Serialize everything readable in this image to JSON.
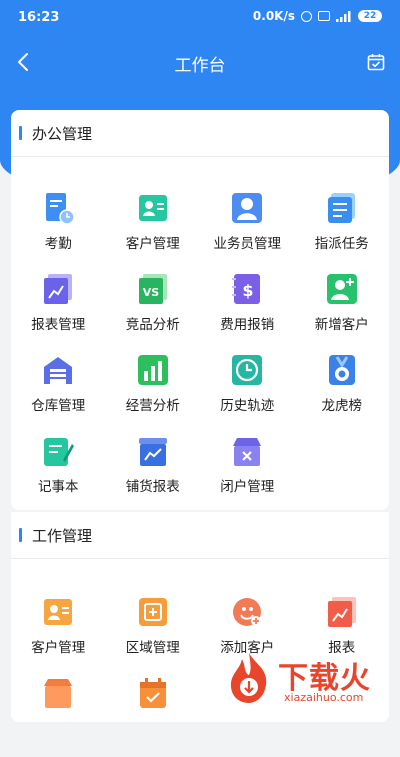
{
  "status_bar": {
    "time": "16:23",
    "network_speed": "0.0K/s",
    "battery": "22"
  },
  "nav": {
    "title": "工作台",
    "back_icon": "chevron-left-icon",
    "right_icon": "calendar-check-icon"
  },
  "colors": {
    "primary": "#2e86f2",
    "section_bar": "#2e86f2"
  },
  "office_section": {
    "title": "办公管理",
    "items": [
      {
        "label": "考勤",
        "icon": "attendance-icon"
      },
      {
        "label": "客户管理",
        "icon": "customer-card-icon"
      },
      {
        "label": "业务员管理",
        "icon": "salesperson-icon"
      },
      {
        "label": "指派任务",
        "icon": "task-list-icon"
      },
      {
        "label": "报表管理",
        "icon": "report-chart-icon"
      },
      {
        "label": "竞品分析",
        "icon": "vs-icon"
      },
      {
        "label": "费用报销",
        "icon": "dollar-notebook-icon"
      },
      {
        "label": "新增客户",
        "icon": "add-user-icon"
      },
      {
        "label": "仓库管理",
        "icon": "warehouse-icon"
      },
      {
        "label": "经营分析",
        "icon": "bar-chart-icon"
      },
      {
        "label": "历史轨迹",
        "icon": "clock-icon"
      },
      {
        "label": "龙虎榜",
        "icon": "medal-icon"
      },
      {
        "label": "记事本",
        "icon": "notepad-icon"
      },
      {
        "label": "铺货报表",
        "icon": "store-chart-icon"
      },
      {
        "label": "闭户管理",
        "icon": "closed-store-icon"
      }
    ]
  },
  "work_section": {
    "title": "工作管理",
    "items": [
      {
        "label": "客户管理",
        "icon": "customer-orange-icon"
      },
      {
        "label": "区域管理",
        "icon": "area-icon"
      },
      {
        "label": "添加客户",
        "icon": "add-customer-icon"
      },
      {
        "label": "报表",
        "icon": "report-orange-icon"
      },
      {
        "label": "",
        "icon": "store-orange-icon"
      },
      {
        "label": "",
        "icon": "calendar-orange-icon"
      }
    ]
  },
  "watermark": {
    "text": "下载火",
    "url": "xiazaihuo.com"
  }
}
